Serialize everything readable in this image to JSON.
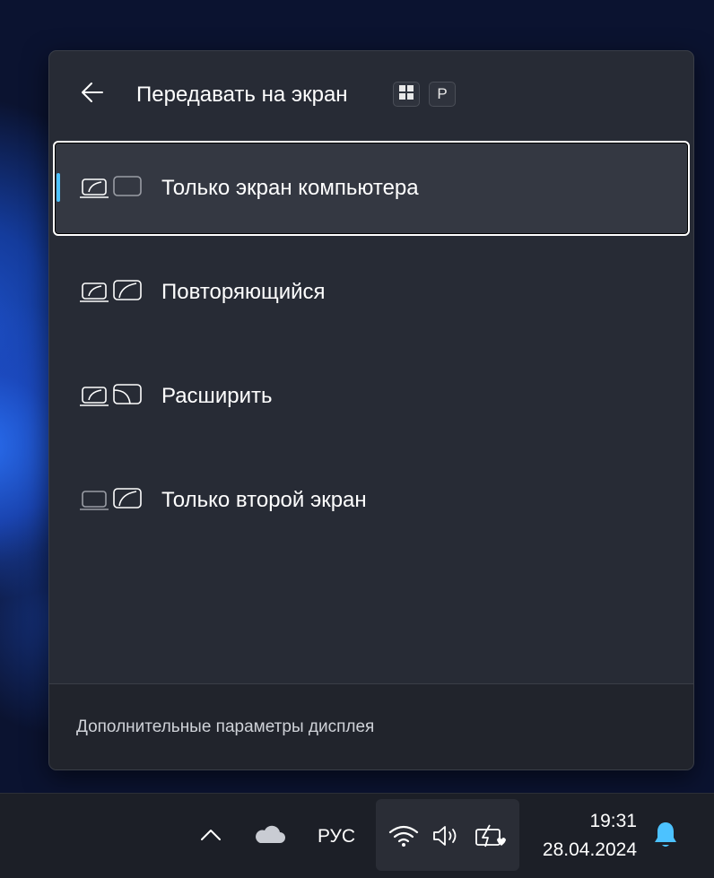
{
  "flyout": {
    "title": "Передавать на экран",
    "shortcut": {
      "key1_icon": "windows-logo-icon",
      "key2": "P"
    },
    "back_icon": "arrow-left-icon",
    "options": [
      {
        "label": "Только экран компьютера",
        "icon": "pc-screen-only-icon",
        "selected": true
      },
      {
        "label": "Повторяющийся",
        "icon": "duplicate-icon",
        "selected": false
      },
      {
        "label": "Расширить",
        "icon": "extend-icon",
        "selected": false
      },
      {
        "label": "Только второй экран",
        "icon": "second-screen-only-icon",
        "selected": false
      }
    ],
    "footer_link": "Дополнительные параметры дисплея"
  },
  "taskbar": {
    "language": "РУС",
    "time": "19:31",
    "date": "28.04.2024",
    "icons": [
      "chevron-up-icon",
      "onedrive-cloud-icon",
      "wifi-icon",
      "volume-icon",
      "battery-charging-icon",
      "notification-bell-icon"
    ]
  },
  "colors": {
    "accent": "#4cc2ff",
    "panel_bg": "#272b35",
    "footer_bg": "#21242c",
    "taskbar_bg": "#1c1f27"
  }
}
